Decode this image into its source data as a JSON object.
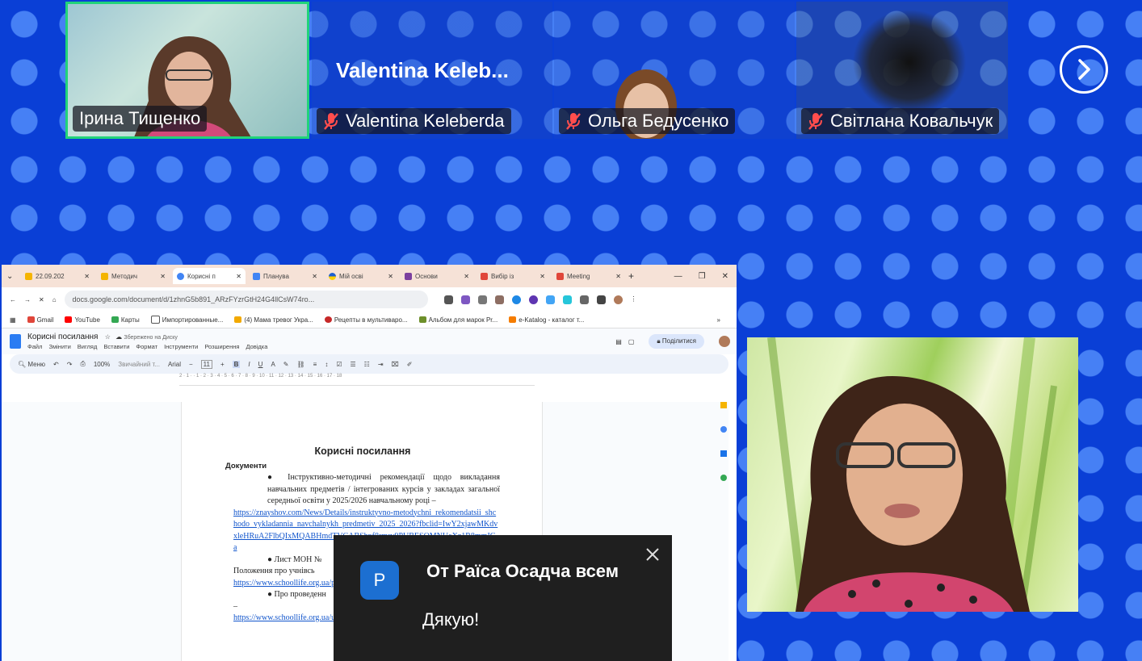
{
  "participants": [
    {
      "name": "Ірина Тищенко",
      "muted": false,
      "active_speaker": true
    },
    {
      "name": "Valentina Keleberda",
      "display_title": "Valentina  Keleb...",
      "muted": true
    },
    {
      "name": "Ольга Бедусенко",
      "muted": true
    },
    {
      "name": "Світлана Ковальчук",
      "muted": true
    }
  ],
  "controls": {
    "next_icon": "chevron-right-icon"
  },
  "shared_screen": {
    "tabs": [
      "22.09.202",
      "Методич",
      "Корисні п",
      "Планува",
      "Мій осві",
      "Основи",
      "Вибір із",
      "Meeting"
    ],
    "url": "docs.google.com/document/d/1zhnG5b891_ARzFYzrGtH24G4llCsW74ro...",
    "bookmarks": [
      "Gmail",
      "YouTube",
      "Карты",
      "Импортированные...",
      "(4) Мама тревог Укра...",
      "Рецепты в мультиваро...",
      "Альбом для марок Pr...",
      "e-Katalog - каталог т..."
    ],
    "doc_title": "Корисні посилання",
    "doc_saved": "Збережено на Диску",
    "doc_menu": [
      "Файл",
      "Змінити",
      "Вигляд",
      "Вставити",
      "Формат",
      "Інструменти",
      "Розширення",
      "Довідка"
    ],
    "share_label": "Поділитися",
    "toolbar": {
      "search": "Меню",
      "zoom": "100%",
      "style": "Звичайний т...",
      "font": "Arial",
      "size": "11"
    },
    "ruler": "2 · 1 · · 1 · 2 · 3 · 4 · 5 · 6 · 7 · 8 · 9 · 10 · 11 · 12 · 13 · 14 · 15 · 16 · 17 · 18",
    "page": {
      "title": "Корисні посилання",
      "section": "Документи",
      "item1": "Інструктивно-методичні рекомендації щодо викладання навчальних предметів / інтегрованих курсів у закладах загальної середньої освіти у 2025/2026 навчальному році –",
      "link1": "https://znayshov.com/News/Details/instruktyvno-metodychni_rekomendatsii_shchodo_vykladannia_navchalnykh_predmetiv_2025_2026?fbclid=IwY2xjawMKdvxleHRuA2FlbQIxMQABHmdTVCABShpf8rmrv9PUBESQMNUaXz1R8mmIG_a",
      "item2": "Лист МОН №",
      "item2b": "Положення про учнівсь",
      "link2": "https://www.schoollife.org.ua/pedvrivla-tsuminvi.rub/",
      "item3": "Про проведенн",
      "dash": "–",
      "link3": "https://www.schoollife.org.ua/ura-uchytel-roku-2025/"
    }
  },
  "chat_toast": {
    "avatar_letter": "Р",
    "from": "От Раїса Осадча всем",
    "message": "Дякую!"
  }
}
